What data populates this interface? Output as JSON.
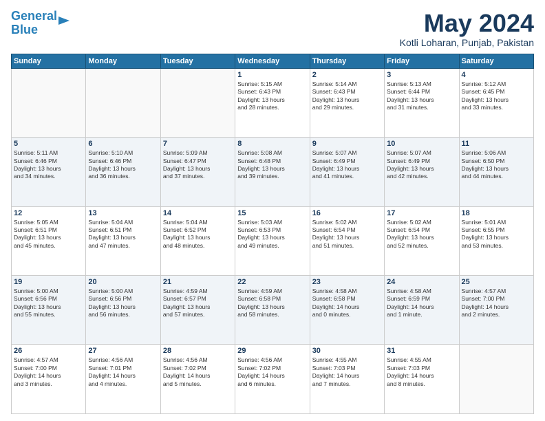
{
  "header": {
    "logo_line1": "General",
    "logo_line2": "Blue",
    "month": "May 2024",
    "location": "Kotli Loharan, Punjab, Pakistan"
  },
  "days_of_week": [
    "Sunday",
    "Monday",
    "Tuesday",
    "Wednesday",
    "Thursday",
    "Friday",
    "Saturday"
  ],
  "weeks": [
    [
      {
        "day": "",
        "info": ""
      },
      {
        "day": "",
        "info": ""
      },
      {
        "day": "",
        "info": ""
      },
      {
        "day": "1",
        "info": "Sunrise: 5:15 AM\nSunset: 6:43 PM\nDaylight: 13 hours\nand 28 minutes."
      },
      {
        "day": "2",
        "info": "Sunrise: 5:14 AM\nSunset: 6:43 PM\nDaylight: 13 hours\nand 29 minutes."
      },
      {
        "day": "3",
        "info": "Sunrise: 5:13 AM\nSunset: 6:44 PM\nDaylight: 13 hours\nand 31 minutes."
      },
      {
        "day": "4",
        "info": "Sunrise: 5:12 AM\nSunset: 6:45 PM\nDaylight: 13 hours\nand 33 minutes."
      }
    ],
    [
      {
        "day": "5",
        "info": "Sunrise: 5:11 AM\nSunset: 6:46 PM\nDaylight: 13 hours\nand 34 minutes."
      },
      {
        "day": "6",
        "info": "Sunrise: 5:10 AM\nSunset: 6:46 PM\nDaylight: 13 hours\nand 36 minutes."
      },
      {
        "day": "7",
        "info": "Sunrise: 5:09 AM\nSunset: 6:47 PM\nDaylight: 13 hours\nand 37 minutes."
      },
      {
        "day": "8",
        "info": "Sunrise: 5:08 AM\nSunset: 6:48 PM\nDaylight: 13 hours\nand 39 minutes."
      },
      {
        "day": "9",
        "info": "Sunrise: 5:07 AM\nSunset: 6:49 PM\nDaylight: 13 hours\nand 41 minutes."
      },
      {
        "day": "10",
        "info": "Sunrise: 5:07 AM\nSunset: 6:49 PM\nDaylight: 13 hours\nand 42 minutes."
      },
      {
        "day": "11",
        "info": "Sunrise: 5:06 AM\nSunset: 6:50 PM\nDaylight: 13 hours\nand 44 minutes."
      }
    ],
    [
      {
        "day": "12",
        "info": "Sunrise: 5:05 AM\nSunset: 6:51 PM\nDaylight: 13 hours\nand 45 minutes."
      },
      {
        "day": "13",
        "info": "Sunrise: 5:04 AM\nSunset: 6:51 PM\nDaylight: 13 hours\nand 47 minutes."
      },
      {
        "day": "14",
        "info": "Sunrise: 5:04 AM\nSunset: 6:52 PM\nDaylight: 13 hours\nand 48 minutes."
      },
      {
        "day": "15",
        "info": "Sunrise: 5:03 AM\nSunset: 6:53 PM\nDaylight: 13 hours\nand 49 minutes."
      },
      {
        "day": "16",
        "info": "Sunrise: 5:02 AM\nSunset: 6:54 PM\nDaylight: 13 hours\nand 51 minutes."
      },
      {
        "day": "17",
        "info": "Sunrise: 5:02 AM\nSunset: 6:54 PM\nDaylight: 13 hours\nand 52 minutes."
      },
      {
        "day": "18",
        "info": "Sunrise: 5:01 AM\nSunset: 6:55 PM\nDaylight: 13 hours\nand 53 minutes."
      }
    ],
    [
      {
        "day": "19",
        "info": "Sunrise: 5:00 AM\nSunset: 6:56 PM\nDaylight: 13 hours\nand 55 minutes."
      },
      {
        "day": "20",
        "info": "Sunrise: 5:00 AM\nSunset: 6:56 PM\nDaylight: 13 hours\nand 56 minutes."
      },
      {
        "day": "21",
        "info": "Sunrise: 4:59 AM\nSunset: 6:57 PM\nDaylight: 13 hours\nand 57 minutes."
      },
      {
        "day": "22",
        "info": "Sunrise: 4:59 AM\nSunset: 6:58 PM\nDaylight: 13 hours\nand 58 minutes."
      },
      {
        "day": "23",
        "info": "Sunrise: 4:58 AM\nSunset: 6:58 PM\nDaylight: 14 hours\nand 0 minutes."
      },
      {
        "day": "24",
        "info": "Sunrise: 4:58 AM\nSunset: 6:59 PM\nDaylight: 14 hours\nand 1 minute."
      },
      {
        "day": "25",
        "info": "Sunrise: 4:57 AM\nSunset: 7:00 PM\nDaylight: 14 hours\nand 2 minutes."
      }
    ],
    [
      {
        "day": "26",
        "info": "Sunrise: 4:57 AM\nSunset: 7:00 PM\nDaylight: 14 hours\nand 3 minutes."
      },
      {
        "day": "27",
        "info": "Sunrise: 4:56 AM\nSunset: 7:01 PM\nDaylight: 14 hours\nand 4 minutes."
      },
      {
        "day": "28",
        "info": "Sunrise: 4:56 AM\nSunset: 7:02 PM\nDaylight: 14 hours\nand 5 minutes."
      },
      {
        "day": "29",
        "info": "Sunrise: 4:56 AM\nSunset: 7:02 PM\nDaylight: 14 hours\nand 6 minutes."
      },
      {
        "day": "30",
        "info": "Sunrise: 4:55 AM\nSunset: 7:03 PM\nDaylight: 14 hours\nand 7 minutes."
      },
      {
        "day": "31",
        "info": "Sunrise: 4:55 AM\nSunset: 7:03 PM\nDaylight: 14 hours\nand 8 minutes."
      },
      {
        "day": "",
        "info": ""
      }
    ]
  ]
}
